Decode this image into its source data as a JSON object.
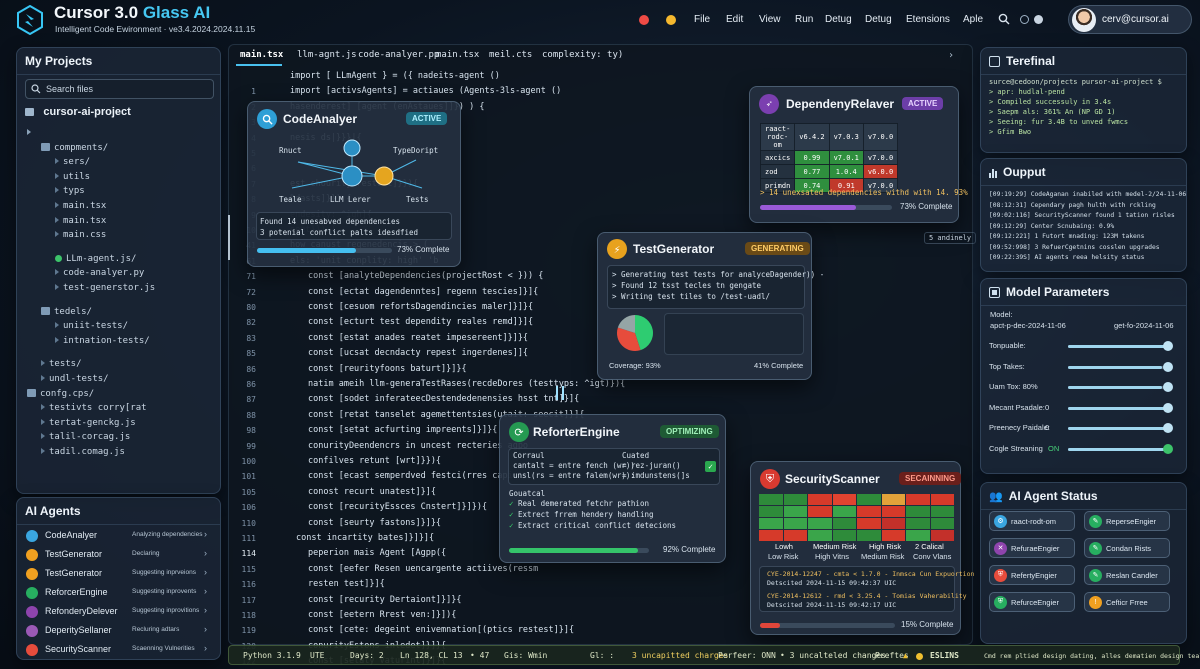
{
  "app": {
    "title_main": "Cursor 3.0",
    "title_accent": "Glass AI",
    "subtitle": "Intelligent Code Ewironment · ve3.4.2024.2024.11.15"
  },
  "menu": [
    "File",
    "Edit",
    "View",
    "Run",
    "Detug",
    "Detug",
    "Etensions",
    "Aple"
  ],
  "user": {
    "email": "cerv@cursor.ai"
  },
  "sidebar": {
    "title": "My Projects",
    "search_placeholder": "Search files",
    "project": "cursor-ai-project",
    "tree": [
      {
        "label": "",
        "kind": "arrow",
        "indent": 0
      },
      {
        "label": "compments/",
        "kind": "folder",
        "indent": 1
      },
      {
        "label": "sers/",
        "kind": "item",
        "indent": 2
      },
      {
        "label": "utils",
        "kind": "item",
        "indent": 2
      },
      {
        "label": "typs",
        "kind": "item",
        "indent": 2
      },
      {
        "label": "main.tsx",
        "kind": "item",
        "indent": 2
      },
      {
        "label": "main.tsx",
        "kind": "item",
        "indent": 2
      },
      {
        "label": "main.css",
        "kind": "item",
        "indent": 2
      },
      {
        "label": "",
        "kind": "blank",
        "indent": 0
      },
      {
        "label": "LLm-agent.js/",
        "kind": "folder-green",
        "indent": 2
      },
      {
        "label": "code-analyer.py",
        "kind": "item",
        "indent": 2
      },
      {
        "label": "test-generstor.js",
        "kind": "item",
        "indent": 2
      },
      {
        "label": "",
        "kind": "blank",
        "indent": 0
      },
      {
        "label": "tedels/",
        "kind": "folder",
        "indent": 1
      },
      {
        "label": "uniit-tests/",
        "kind": "item",
        "indent": 2
      },
      {
        "label": "intnation-tests/",
        "kind": "item",
        "indent": 2
      },
      {
        "label": "",
        "kind": "blank",
        "indent": 0
      },
      {
        "label": "tests/",
        "kind": "item",
        "indent": 1
      },
      {
        "label": "undl-tests/",
        "kind": "item",
        "indent": 1
      },
      {
        "label": "confg.cps/",
        "kind": "folder",
        "indent": 0
      },
      {
        "label": "testivts corry[rat",
        "kind": "item",
        "indent": 1
      },
      {
        "label": "tertat-genckg.js",
        "kind": "item",
        "indent": 1
      },
      {
        "label": "talil-corcag.js",
        "kind": "item",
        "indent": 1
      },
      {
        "label": "tadil.comag.js",
        "kind": "item",
        "indent": 1
      }
    ]
  },
  "agents_panel": {
    "title": "AI Agents",
    "items": [
      {
        "name": "CodeAnalyer",
        "status": "Analyzing dependencies",
        "color": "#3aa6e0"
      },
      {
        "name": "TestGenerator",
        "status": "Declaring",
        "color": "#f0a020"
      },
      {
        "name": "TestGenerator",
        "status": "Suggesting inprveions",
        "color": "#f0a020"
      },
      {
        "name": "ReforcerEngine",
        "status": "Suggesting inprovents",
        "color": "#27ae60"
      },
      {
        "name": "RefonderyDelever",
        "status": "Suggesting inprovitions",
        "color": "#8e44ad"
      },
      {
        "name": "DeperitySellaner",
        "status": "Recluring adtars",
        "color": "#9b59b6"
      },
      {
        "name": "SecurityScanner",
        "status": "Scaenning Vulnerities",
        "color": "#e74c3c"
      }
    ]
  },
  "editor": {
    "tabs": [
      "main.tsx",
      "llm-agnt.js",
      "code-analyer.pp",
      "main.tsx",
      "meil.cts",
      "complexity: ty)"
    ],
    "line_numbers": [
      "",
      "1",
      "2",
      "3",
      "4",
      "5",
      "6",
      "7",
      "8",
      "9",
      "10",
      "41",
      "61",
      "71",
      "72",
      "80",
      "82",
      "83",
      "85",
      "86",
      "86",
      "87",
      "88",
      "98",
      "99",
      "100",
      "101",
      "105",
      "106",
      "110",
      "111",
      "114",
      "115",
      "116",
      "117",
      "118",
      "119",
      "120",
      "122"
    ],
    "lines": [
      "import [ LLmAgent } = ({ nadeits-agent ()",
      "import [activsAgents] = actiaues (Agents-3ls-agent ()",
      "        hasenderest] [agent (enAstaues]]}) ) {",
      "",
      "        nesis ds|}}}|{",
      "",
      "",
      "        est chourity restust]}}){",
      "        Ddasts]}}) {",
      "        endesity: ^igh]{",
      "        eeet}}) {",
      "        how canust regenedencis > (",
      "        els: 'unit conplity: high' 'b",
      "const [analyteDependencies(projectRost < })) {",
      "const [ectat dagendenntes] regenn tescies]}]{",
      "const [cesuom refortsDagendincies maler]}]}{",
      "const [ecturt test dependity reales remd]}]{",
      "const [estat anades reatet impesereent]}]}{",
      "const [ucsat decndacty repest ingerdenes]]{",
      "const [reurityfoons baturt]}]}{",
      "natim ameih llm-generaTestRases(recdeDores (testtyps: ^igt)}){",
      "const [sodet inferateecDestendedenensies hsst tnt]}]{",
      "const [retat tanselet agemettentsies(utait: seecit]}]{",
      "const [setat acfurting impreents]}]}{",
      "conurityDeendencrs in uncest recteries agpo",
      "confilves retunt [wrt]}}){",
      "const [ecast semperdved festci(rres capicts",
      "conost recurt unatest]}]{",
      "const [recurityEssces Cnstert]}]}){",
      "const [seurty fastons]}]}{",
      "const incartity bates]}]}]{",
      "peperion mais Agent [Agpp({",
      "const [eefer Resen uencargente actiives(ressm",
      "resten test]}]{",
      "const [recurity Dertaiont]}]}{",
      "const [eetern Rrest ven:]}]){",
      "const [cete: degeint enivemnation[(ptics restest]}]{",
      "conurityEstons inledet]}]}{",
      "const [setaty Vaturint]}]}{"
    ]
  },
  "code_analyzer": {
    "title": "CodeAnalyer",
    "badge": "ACTIVE",
    "nodes": {
      "top_left": "Rnuct",
      "top_right": "TypeDoript",
      "bot_left": "Teale",
      "center": "LLM Lerer",
      "bot_right": "Tests"
    },
    "line1": "Found 14 unesabved dependencies",
    "line2": "3 potenial conflict palts idesdfied",
    "progress": 0.73,
    "progress_label": "73% Complete"
  },
  "dependency": {
    "title": "DependenyRelaver",
    "badge": "ACTIVE",
    "headers": [
      "raact-rodc-om",
      "v6.4.2",
      "v7.0.3",
      "v7.0.0"
    ],
    "rows": [
      {
        "name": "axcics",
        "cells": [
          "0.99",
          "v7.0.1",
          "v7.0.0"
        ]
      },
      {
        "name": "zod",
        "cells": [
          "0.77",
          "1.0.4",
          "v6.0.0"
        ]
      },
      {
        "name": "primdn",
        "cells": [
          "0.74",
          "0.91",
          "v7.0.0"
        ]
      }
    ],
    "note": "> 14 unexsated dependencies withd with 14. 93%",
    "progress": 0.73,
    "progress_label": "73% Complete",
    "anomaly": "5 andinely"
  },
  "test_gen": {
    "title": "TestGenerator",
    "badge": "GENERATING",
    "lines": [
      "> Generating test tests for analyceDagender)) -",
      "> Found 12 tsst tecles tn gengate",
      "> Writing test tiles to /test-uadl/"
    ],
    "coverage": "Coverage:  93%",
    "progress_label": "41% Complete",
    "pie": [
      {
        "value": 0.45,
        "color": "#2ecc71"
      },
      {
        "value": 0.35,
        "color": "#e74c3c"
      },
      {
        "value": 0.2,
        "color": "#95a5a6"
      }
    ]
  },
  "refactor": {
    "title": "ReforterEngine",
    "badge": "OPTIMIZING",
    "col1_title": "Corraul",
    "col2_title": "Cuated",
    "col1": [
      "cantalt  = entre fench (wr))",
      "unsl(rs  = entre falem(wr)):"
    ],
    "col2": [
      "= rez-juran()",
      "= imdunstens(]s"
    ],
    "suggest_title": "Gouatcal",
    "suggestions": [
      "Real demerated fetchr pathion",
      "Extrect frrem hendery handling",
      "Extract critical conflict detecions"
    ],
    "progress": 0.92,
    "progress_label": "92% Complete"
  },
  "security": {
    "title": "SecurityScanner",
    "badge": "SECAINNING",
    "legend": [
      "Low Risk",
      "High Vitns",
      "Medium Risk",
      "Conv Vlans"
    ],
    "legend_top": [
      "Lowh",
      "Medium Risk",
      "High Risk",
      "2 Calical"
    ],
    "heat_colors": [
      "#2e8b3a",
      "#2e8b3a",
      "#d63a2a",
      "#e14330",
      "#2e8b3a",
      "#e2a23a",
      "#d63a2a",
      "#d63a2a",
      "#2e8b3a",
      "#3aa54a",
      "#d63a2a",
      "#3aa54a",
      "#d63a2a",
      "#d63a2a",
      "#2e8b3a",
      "#2e8b3a",
      "#3aa54a",
      "#3aa54a",
      "#3aa54a",
      "#2e8b3a",
      "#d63a2a",
      "#c3302a",
      "#2e8b3a",
      "#2e8b3a",
      "#d63a2a",
      "#d63a2a",
      "#3aa54a",
      "#2e8b3a",
      "#2e8b3a",
      "#d63a2a",
      "#3aa54a",
      "#c3302a"
    ],
    "cve1": "CYE-2014-12247 - cmta < 1.7.0 - Inmsca Cun Expuortion",
    "cve1_date": "Detscited 2024-11-15 09:42:37 UIC",
    "cve2": "CYE-2014-12612 - rmd < 3.25.4 - Tomias Vaherability",
    "cve2_date": "Detscited 2024-11-15 09:42:17 UIC",
    "progress": 0.15,
    "progress_label": "15% Complete"
  },
  "terminal": {
    "title": "Terefinal",
    "lines": [
      "surce@cedoon/projects pursor-ai-project $",
      "> apr: hudlal-pend",
      "> Compiled successuly in 3.4s",
      "> Saepm als: 361% An (NP GD 1)",
      "> Seeing: fur 3.4B to unved fwmcs",
      "> Gfim Bwo"
    ]
  },
  "output": {
    "title": "Oupput",
    "lines": [
      "[09:19:29] CodeAganan inabiled with medel-2/24-11-06",
      "[08:12:31] Cependary pagh hulth with rckling",
      "[09:02:116] SecurityScanner found 1 tation risles",
      "[09:12:29] Center Scnubaing: 0.9%",
      "[09:12:221] 1 Futort mnading: 123M takens",
      "[09:52:998] 3 RefuerCgetnins cosslen upgrades",
      "[09:22:39S] AI agents reea helsity status"
    ]
  },
  "model": {
    "title": "Model Parameters",
    "model_label": "Model:",
    "model_a": "apct-p-dec-2024-11-06",
    "model_b": "get-fo-2024-11-06",
    "params": [
      {
        "label": "Tonpuable:",
        "value": "",
        "level": 0.95
      },
      {
        "label": "Top Takes:",
        "value": "",
        "level": 0.92
      },
      {
        "label": "Uam Tox: 80%",
        "value": "",
        "level": 0.92
      },
      {
        "label": "Mecant Psadale:",
        "value": "0",
        "level": 0.95
      },
      {
        "label": "Preenecy Paidale:",
        "value": "0",
        "level": 0.95
      },
      {
        "label": "Cogle Streaning",
        "value": "ON",
        "level": 0.95
      }
    ]
  },
  "agent_status": {
    "title": "AI Agent Status",
    "items": [
      {
        "label": "raact-rodt-om",
        "color": "#3aa6e0",
        "icon": "gear"
      },
      {
        "label": "ReperseEngier",
        "color": "#27ae60",
        "icon": "wrench"
      },
      {
        "label": "RefuraeEngier",
        "color": "#8e44ad",
        "icon": "cross"
      },
      {
        "label": "Condan Rists",
        "color": "#27ae60",
        "icon": "wrench"
      },
      {
        "label": "RefertyEngier",
        "color": "#e74c3c",
        "icon": "shield"
      },
      {
        "label": "Reslan Candler",
        "color": "#27ae60",
        "icon": "wrench"
      },
      {
        "label": "RefurceEngier",
        "color": "#27ae60",
        "icon": "shield"
      },
      {
        "label": "Cefticr Frree",
        "color": "#f0a020",
        "icon": "warning"
      }
    ]
  },
  "statusbar": {
    "python": "Python 3.1.9",
    "enc": "UTE",
    "days": "Days: 2",
    "pos": "Ln 128, CL 13",
    "n": "• 47",
    "git": "Gis: Wmin",
    "gl": "Gl: :",
    "changes1": "3 uncapitted charges",
    "perfeer": "Perfeer: ONN",
    "changes2": "• 3 uncalteled changes",
    "prettes": "Preftes",
    "eslins": "ESLINS",
    "msg": "Cmd rem pltied design dating, alles dematien design tealdy"
  }
}
